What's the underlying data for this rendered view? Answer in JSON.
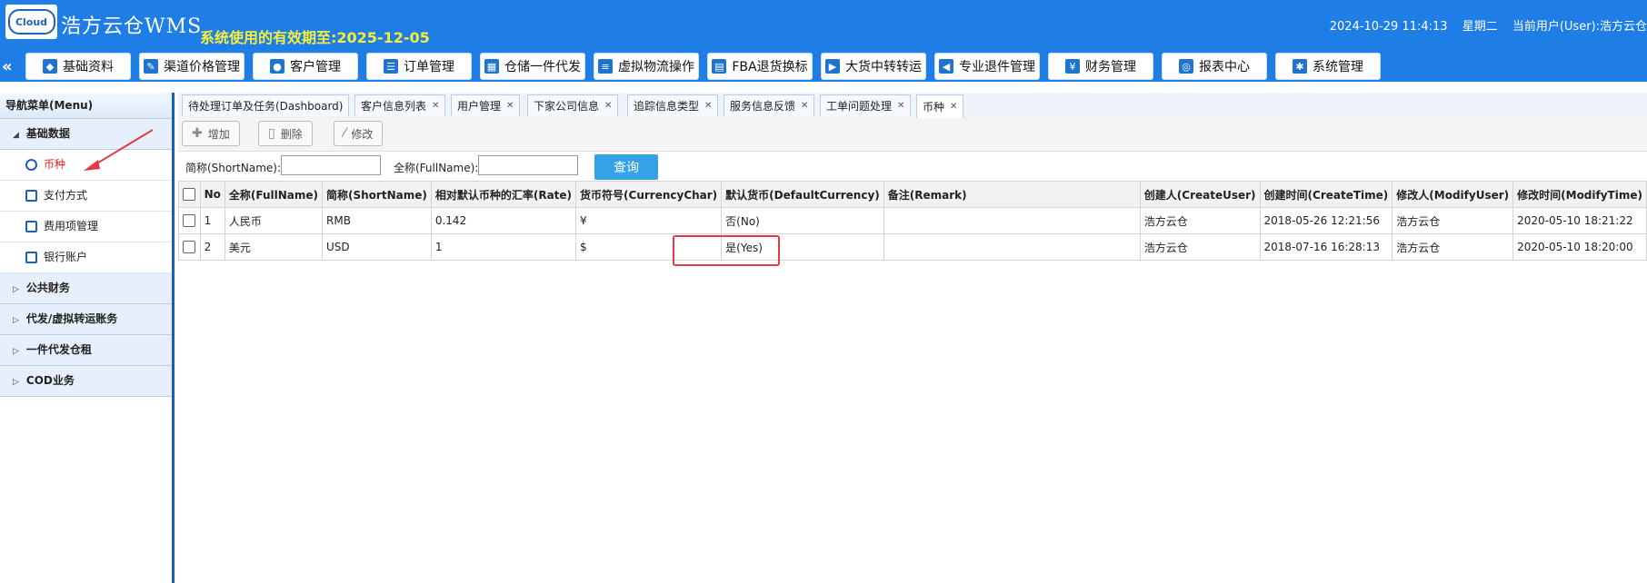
{
  "header": {
    "logo_text": "Cloud",
    "brand": "浩方云仓WMS",
    "validity": "系统使用的有效期至:2025-12-05",
    "datetime": "2024-10-29 11:4:13",
    "weekday": "星期二",
    "user": "当前用户(User):浩方云仓"
  },
  "nav": {
    "collapse": "«",
    "buttons": [
      "基础资料",
      "渠道价格管理",
      "客户管理",
      "订单管理",
      "仓储一件代发",
      "虚拟物流操作",
      "FBA退货换标",
      "大货中转转运",
      "专业退件管理",
      "财务管理",
      "报表中心",
      "系统管理"
    ]
  },
  "sidebar": {
    "title": "导航菜单(Menu)",
    "groups": [
      "基础数据",
      "公共财务",
      "代发/虚拟转运账务",
      "一件代发仓租",
      "COD业务"
    ],
    "items": [
      "币种",
      "支付方式",
      "费用项管理",
      "银行账户"
    ]
  },
  "tabs": [
    "待处理订单及任务(Dashboard)",
    "客户信息列表",
    "用户管理",
    "下家公司信息",
    "追踪信息类型",
    "服务信息反馈",
    "工单问题处理",
    "币种"
  ],
  "toolbar": {
    "add": "增加",
    "delete": "删除",
    "edit": "修改"
  },
  "search": {
    "short_label": "简称(ShortName):",
    "full_label": "全称(FullName):",
    "query": "查询"
  },
  "table": {
    "headers": [
      "No",
      "全称(FullName)",
      "简称(ShortName)",
      "相对默认币种的汇率(Rate)",
      "货币符号(CurrencyChar)",
      "默认货币(DefaultCurrency)",
      "备注(Remark)",
      "创建人(CreateUser)",
      "创建时间(CreateTime)",
      "修改人(ModifyUser)",
      "修改时间(ModifyTime)"
    ],
    "rows": [
      [
        "1",
        "人民币",
        "RMB",
        "0.142",
        "¥",
        "否(No)",
        "",
        "浩方云仓",
        "2018-05-26 12:21:56",
        "浩方云仓",
        "2020-05-10 18:21:22"
      ],
      [
        "2",
        "美元",
        "USD",
        "1",
        "$",
        "是(Yes)",
        "",
        "浩方云仓",
        "2018-07-16 16:28:13",
        "浩方云仓",
        "2020-05-10 18:20:00"
      ]
    ]
  },
  "colors": {
    "header_bg": "#1e7ee6",
    "validity": "#f7ee3a",
    "active_menu": "#e02020",
    "highlight": "#e23a47"
  }
}
